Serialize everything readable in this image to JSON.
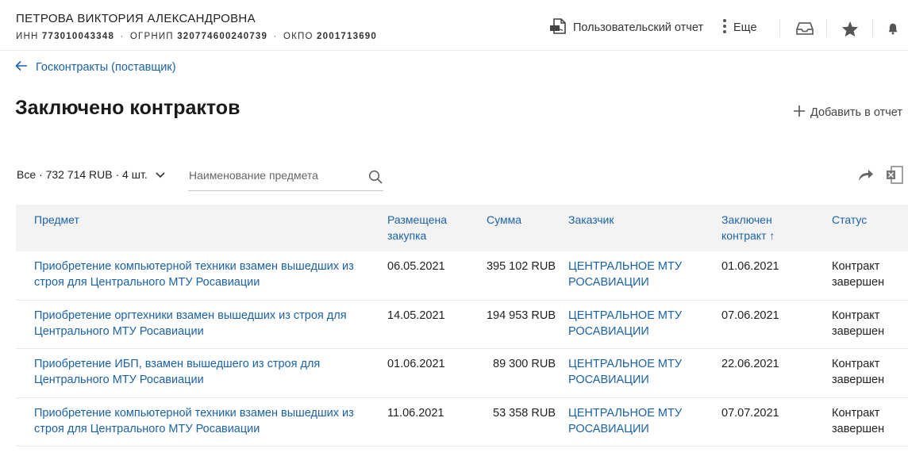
{
  "header": {
    "company_name": "ПЕТРОВА ВИКТОРИЯ АЛЕКСАНДРОВНА",
    "inn_label": "ИНН",
    "inn": "773010043348",
    "ogrnip_label": "ОГРНИП",
    "ogrnip": "320774600240739",
    "okpo_label": "ОКПО",
    "okpo": "2001713690",
    "separator": "·",
    "report_label": "Пользовательский отчет",
    "more_label": "Еще"
  },
  "breadcrumb": {
    "back_label": "Госконтракты (поставщик)"
  },
  "page": {
    "title": "Заключено контрактов",
    "add_label": "Добавить в отчет"
  },
  "filter": {
    "summary": "Все · 732 714 RUB · 4 шт.",
    "search_placeholder": "Наименование предмета"
  },
  "table": {
    "columns": {
      "subject": "Предмет",
      "posted_line1": "Размещена",
      "posted_line2": "закупка",
      "sum": "Сумма",
      "customer": "Заказчик",
      "concluded_line1": "Заключен",
      "concluded_line2": "контракт ↑",
      "status": "Статус"
    },
    "rows": [
      {
        "subject_line1": "Приобретение компьютерной техники взамен вышедших из",
        "subject_line2": "строя для Центрального МТУ Росавиации",
        "posted": "06.05.2021",
        "sum": "395 102 RUB",
        "customer_line1": "ЦЕНТРАЛЬНОЕ МТУ",
        "customer_line2": "РОСАВИАЦИИ",
        "concluded": "01.06.2021",
        "status_line1": "Контракт",
        "status_line2": "завершен"
      },
      {
        "subject_line1": "Приобретение оргтехники взамен вышедших из строя для",
        "subject_line2": "Центрального МТУ Росавиации",
        "posted": "14.05.2021",
        "sum": "194 953 RUB",
        "customer_line1": "ЦЕНТРАЛЬНОЕ МТУ",
        "customer_line2": "РОСАВИАЦИИ",
        "concluded": "07.06.2021",
        "status_line1": "Контракт",
        "status_line2": "завершен"
      },
      {
        "subject_line1": "Приобретение ИБП, взамен вышедшего из строя для",
        "subject_line2": "Центрального МТУ Росавиации",
        "posted": "01.06.2021",
        "sum": "89 300 RUB",
        "customer_line1": "ЦЕНТРАЛЬНОЕ МТУ",
        "customer_line2": "РОСАВИАЦИИ",
        "concluded": "22.06.2021",
        "status_line1": "Контракт",
        "status_line2": "завершен"
      },
      {
        "subject_line1": "Приобретение компьютерной техники взамен вышедших из",
        "subject_line2": "строя для Центрального МТУ Росавиации",
        "posted": "11.06.2021",
        "sum": "53 358 RUB",
        "customer_line1": "ЦЕНТРАЛЬНОЕ МТУ",
        "customer_line2": "РОСАВИАЦИИ",
        "concluded": "07.07.2021",
        "status_line1": "Контракт",
        "status_line2": "завершен"
      }
    ]
  },
  "icons": {
    "pdf": "pdf-icon",
    "more": "vertical-dots-icon",
    "inbox": "inbox-tray-icon",
    "star": "star-icon",
    "bell": "bell-icon",
    "back": "arrow-left-icon",
    "add": "plus-icon",
    "dropdown": "chevron-down-icon",
    "search": "search-icon",
    "share": "share-arrow-icon",
    "excel": "excel-export-icon"
  },
  "colors": {
    "link": "#1a62a6",
    "header_bg": "#f3f3f3",
    "text": "#222222"
  }
}
